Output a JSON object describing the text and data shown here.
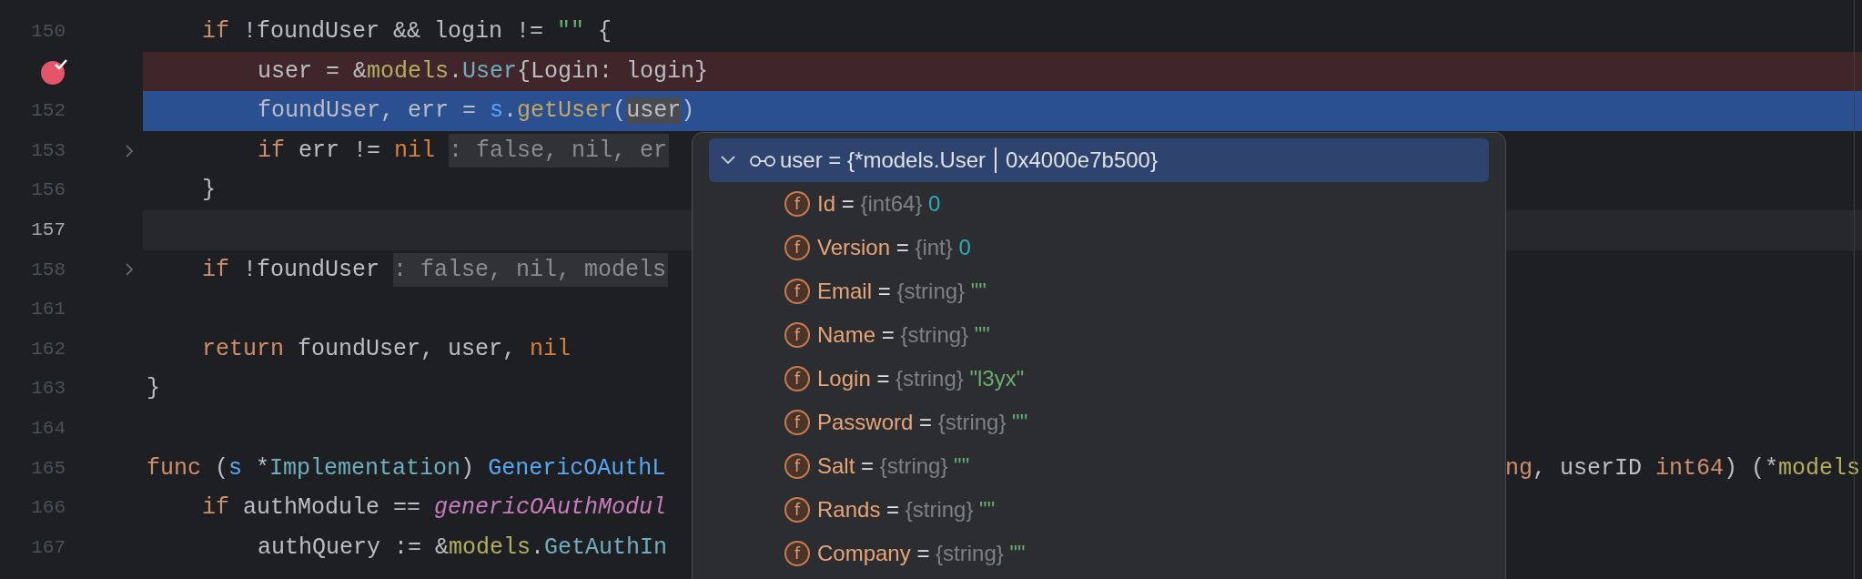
{
  "editor": {
    "lines": [
      {
        "children": [
          {
            "number": "150",
            "breakpoint": false,
            "executing": false,
            "current": false,
            "foldable": false,
            "tokens": [
              {
                "t": "if",
                "kind": "keyword"
              },
              {
                "t": " !foundUser && login != ",
                "kind": "plain"
              },
              {
                "t": "\"\"",
                "kind": "string"
              },
              {
                "t": " {",
                "kind": "plain"
              }
            ]
          },
          {
            "children": [
              {
                "breakpoint": true,
                "executing": false,
                "foldable": false,
                "tokens": [
                  {
                    "t": "user = &",
                    "kind": "plain"
                  },
                  {
                    "t": "models",
                    "kind": "package"
                  },
                  {
                    "t": ".",
                    "kind": "plain"
                  },
                  {
                    "t": "User",
                    "kind": "type"
                  },
                  {
                    "t": "{Login: login}",
                    "kind": "plain"
                  }
                ]
              },
              {
                "number": "152",
                "breakpoint": false,
                "executing": true,
                "current": false,
                "foldable": false,
                "tokens": [
                  {
                    "t": "foundUser, err = ",
                    "kind": "plain"
                  },
                  {
                    "t": "s",
                    "kind": "receiver"
                  },
                  {
                    "t": ".",
                    "kind": "plain"
                  },
                  {
                    "t": "getUser",
                    "kind": "call"
                  },
                  {
                    "t": "(",
                    "kind": "plain"
                  },
                  {
                    "t": "user",
                    "kind": "selected"
                  },
                  {
                    "t": ")",
                    "kind": "plain"
                  }
                ]
              },
              {
                "number": "153",
                "breakpoint": false,
                "executing": false,
                "current": false,
                "foldable": true,
                "tokens": [
                  {
                    "t": "if",
                    "kind": "keyword"
                  },
                  {
                    "t": " err != ",
                    "kind": "plain"
                  },
                  {
                    "t": "nil",
                    "kind": "constant"
                  },
                  {
                    "t": ": false, nil, er",
                    "kind": "hint"
                  }
                ]
              }
            ]
          },
          {
            "number": "156",
            "breakpoint": false,
            "executing": false,
            "current": false,
            "foldable": false,
            "tokens": [
              {
                "t": "}",
                "kind": "plain"
              }
            ]
          },
          {
            "number": "157",
            "breakpoint": false,
            "executing": false,
            "current": true,
            "foldable": false
          },
          {
            "number": "158",
            "breakpoint": false,
            "executing": false,
            "current": false,
            "foldable": true,
            "tokens": [
              {
                "t": "if",
                "kind": "keyword"
              },
              {
                "t": " !foundUser",
                "kind": "plain"
              },
              {
                "t": ": false, nil, models",
                "kind": "hint"
              }
            ]
          },
          {
            "number": "161",
            "breakpoint": false,
            "executing": false,
            "current": false,
            "foldable": false
          },
          {
            "number": "162",
            "breakpoint": false,
            "executing": false,
            "current": false,
            "foldable": false,
            "tokens": [
              {
                "t": "return",
                "kind": "keyword"
              },
              {
                "t": " foundUser, user, ",
                "kind": "plain"
              },
              {
                "t": "nil",
                "kind": "constant"
              }
            ]
          }
        ]
      },
      {
        "number": "163",
        "breakpoint": false,
        "executing": false,
        "current": false,
        "foldable": false,
        "tokens": [
          {
            "t": "}",
            "kind": "plain"
          }
        ]
      },
      {
        "number": "164",
        "breakpoint": false,
        "executing": false,
        "current": false,
        "foldable": false
      },
      {
        "number": "165",
        "breakpoint": false,
        "executing": false,
        "current": false,
        "foldable": false,
        "tokens": [
          {
            "t": "func",
            "kind": "keyword"
          },
          {
            "t": " (",
            "kind": "plain"
          },
          {
            "t": "s",
            "kind": "receiver"
          },
          {
            "t": " *",
            "kind": "plain"
          },
          {
            "t": "Implementation",
            "kind": "type"
          },
          {
            "t": ") ",
            "kind": "plain"
          },
          {
            "t": "GenericOAuthL",
            "kind": "receiver"
          }
        ],
        "tail": [
          {
            "t": "ng",
            "kind": "keyword"
          },
          {
            "t": ", userID ",
            "kind": "plain"
          },
          {
            "t": "int64",
            "kind": "keyword"
          },
          {
            "t": ") (*",
            "kind": "plain"
          },
          {
            "t": "models",
            "kind": "package"
          }
        ]
      },
      {
        "children": [
          {
            "number": "166",
            "breakpoint": false,
            "executing": false,
            "current": false,
            "foldable": false,
            "tokens": [
              {
                "t": "if",
                "kind": "keyword"
              },
              {
                "t": " authModule == ",
                "kind": "plain"
              },
              {
                "t": "genericOAuthModul",
                "kind": "global"
              }
            ]
          },
          {
            "children": [
              {
                "number": "167",
                "breakpoint": false,
                "executing": false,
                "current": false,
                "foldable": false,
                "tokens": [
                  {
                    "t": "authQuery := &",
                    "kind": "plain"
                  },
                  {
                    "t": "models",
                    "kind": "package"
                  },
                  {
                    "t": ".",
                    "kind": "plain"
                  },
                  {
                    "t": "GetAuthIn",
                    "kind": "type"
                  }
                ]
              }
            ]
          }
        ]
      }
    ]
  },
  "popup": {
    "header": {
      "expanded": true,
      "selected": true,
      "label": "user = {*models.User",
      "address": "0x4000e7b500}"
    },
    "fields": [
      {
        "badge": "f",
        "name": "Id",
        "eq": "=",
        "type": "{int64}",
        "value": "0",
        "kind": "number"
      },
      {
        "badge": "f",
        "name": "Version",
        "eq": "=",
        "type": "{int}",
        "value": "0",
        "kind": "number"
      },
      {
        "badge": "f",
        "name": "Email",
        "eq": "=",
        "type": "{string}",
        "value": "\"\"",
        "kind": "string"
      },
      {
        "badge": "f",
        "name": "Name",
        "eq": "=",
        "type": "{string}",
        "value": "\"\"",
        "kind": "string"
      },
      {
        "badge": "f",
        "name": "Login",
        "eq": "=",
        "type": "{string}",
        "value": "\"l3yx\"",
        "kind": "string"
      },
      {
        "badge": "f",
        "name": "Password",
        "eq": "=",
        "type": "{string}",
        "value": "\"\"",
        "kind": "string"
      },
      {
        "badge": "f",
        "name": "Salt",
        "eq": "=",
        "type": "{string}",
        "value": "\"\"",
        "kind": "string"
      },
      {
        "badge": "f",
        "name": "Rands",
        "eq": "=",
        "type": "{string}",
        "value": "\"\"",
        "kind": "string"
      },
      {
        "badge": "f",
        "name": "Company",
        "eq": "=",
        "type": "{string}",
        "value": "\"\"",
        "kind": "string"
      }
    ]
  }
}
